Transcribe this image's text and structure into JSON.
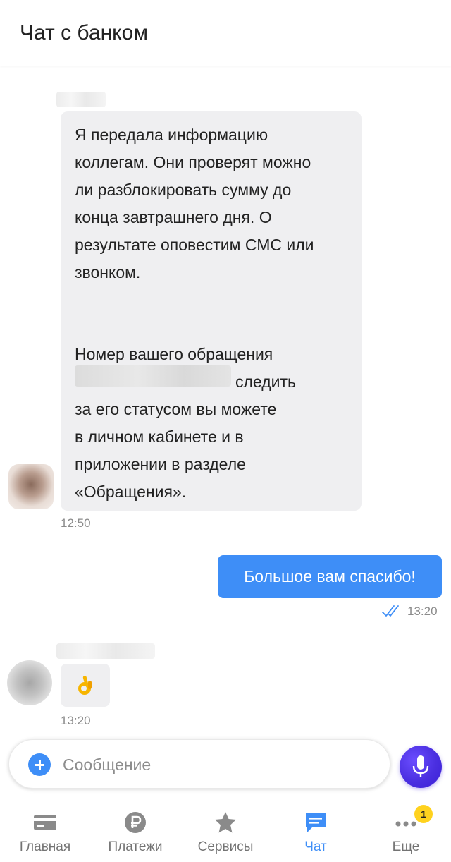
{
  "header": {
    "title": "Чат с банком"
  },
  "messages": {
    "incoming1": {
      "part1": "Я передала информацию\nколлегам. Они проверят можно\nли разблокировать сумму до\nконца завтрашнего дня. О\nрезультате оповестим СМС или\nзвонком.",
      "part2_line1": "Номер вашего обращения",
      "part2_line2": "следить",
      "part2_line3": "за его статусом вы можете",
      "part2_line4": "в личном кабинете и в",
      "part2_line5": "приложении в разделе",
      "part2_line6": "«Обращения».",
      "time": "12:50"
    },
    "outgoing1": {
      "text": "Большое вам спасибо!",
      "time": "13:20",
      "status_icon": "double-check-icon"
    },
    "incoming2": {
      "emoji": "ok-hand-icon",
      "time": "13:20"
    }
  },
  "composer": {
    "placeholder": "Сообщение",
    "value": ""
  },
  "tabs": [
    {
      "label": "Главная",
      "icon": "card-icon"
    },
    {
      "label": "Платежи",
      "icon": "ruble-icon"
    },
    {
      "label": "Сервисы",
      "icon": "star-icon"
    },
    {
      "label": "Чат",
      "icon": "chat-icon"
    },
    {
      "label": "Еще",
      "icon": "more-icon"
    }
  ],
  "badge": {
    "count": "1"
  },
  "colors": {
    "accent": "#3e8ef7",
    "mic": "#4a2fe0",
    "badge": "#ffd21e",
    "bubble_in": "#efeff1"
  }
}
